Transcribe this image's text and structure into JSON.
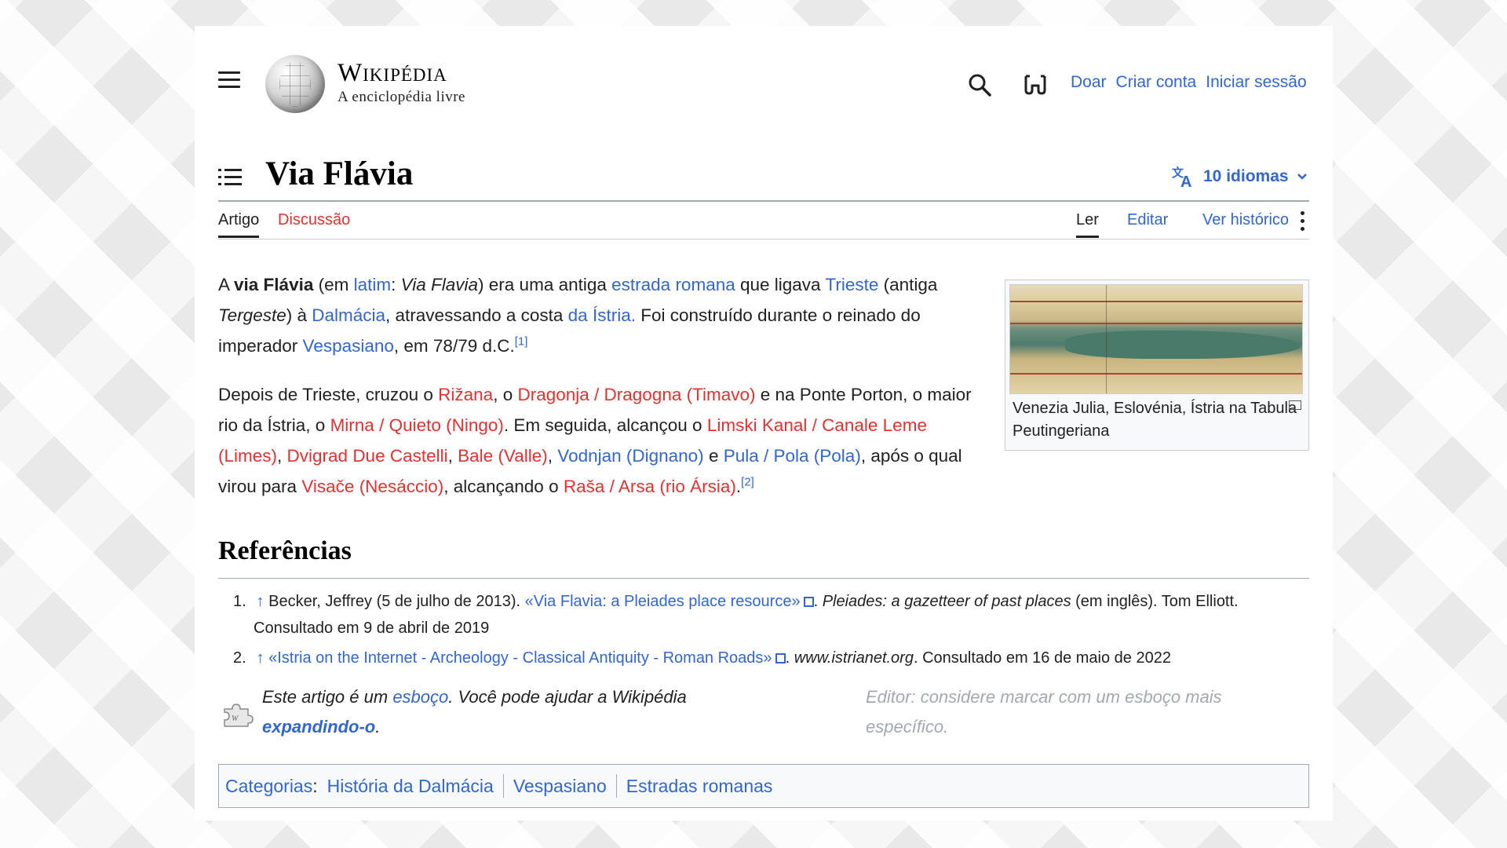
{
  "header": {
    "wordmark_title": "Wikipédia",
    "wordmark_tagline": "A enciclopédia livre",
    "links": [
      "Doar",
      "Criar conta",
      "Iniciar sessão"
    ]
  },
  "title_bar": {
    "title": "Via Flávia",
    "languages_label": "10 idiomas"
  },
  "tabs": {
    "left": [
      "Artigo",
      "Discussão"
    ],
    "right": [
      "Ler",
      "Editar",
      "Ver histórico"
    ]
  },
  "content": {
    "p1": {
      "t1": "A ",
      "bold": "via Flávia",
      "t2": " (em ",
      "l_latim": "latim",
      "t3": ": ",
      "i_latin": "Via Flavia",
      "t4": ") era uma antiga ",
      "l_estrada": "estrada romana",
      "t5": " que ligava ",
      "l_trieste": "Trieste",
      "t6": " (antiga ",
      "i_tergeste": "Tergeste",
      "t7": ") à ",
      "l_dalmacia": "Dalmácia",
      "t8": ", atravessando a costa ",
      "l_istria": "da Ístria.",
      "t9": " Foi construído durante o reinado do imperador ",
      "l_vespasiano": "Vespasiano",
      "t10": ", em 78/79 d.C.",
      "ref": "[1]"
    },
    "p2": {
      "t1": "Depois de Trieste, cruzou o ",
      "r_rizana": "Rižana",
      "t2": ", o ",
      "r_dragonja": "Dragonja / Dragogna (Timavo)",
      "t3": " e na Ponte Porton, o maior rio da Ístria, o ",
      "r_mirna": "Mirna / Quieto (Ningo)",
      "t4": ". Em seguida, alcançou o ",
      "r_limski": "Limski Kanal / Canale Leme (Limes)",
      "t5": ", ",
      "r_dvigrad": "Dvigrad Due Castelli",
      "t6": ", ",
      "r_bale": "Bale (Valle)",
      "t7": ", ",
      "l_vodnjan": "Vodnjan (Dignano)",
      "t8": " e ",
      "l_pula": "Pula / Pola (Pola)",
      "t9": ", após o qual virou para ",
      "r_visace": "Visače (Nesáccio)",
      "t10": ", alcançando o ",
      "r_rasa": "Raša / Arsa (rio Ársia)",
      "t11": ".",
      "ref": "[2]"
    }
  },
  "thumbnail": {
    "caption": "Venezia Julia, Eslovénia, Ístria na Tabula Peutingeriana"
  },
  "references": {
    "heading": "Referências",
    "items": [
      {
        "num": "1.",
        "arrow": "↑",
        "author": " Becker, Jeffrey (5 de julho de 2013). ",
        "link": "«Via Flavia: a Pleiades place resource»",
        "work": "Pleiades: a gazetteer of past places",
        "rest": " (em inglês). Tom Elliott. Consultado em 9 de abril de 2019"
      },
      {
        "num": "2.",
        "arrow": "↑",
        "link": "«Istria on the Internet - Archeology - Classical Antiquity - Roman Roads»",
        "work": "www.istrianet.org",
        "rest": ". Consultado em 16 de maio de 2022"
      }
    ]
  },
  "stub": {
    "t1": "Este artigo é um ",
    "l_esboco": "esboço",
    "t2": ". Você pode ajudar a Wikipédia ",
    "l_expand": "expandindo-o",
    "t3": ".",
    "r1": "Editor: considere marcar com um ",
    "r_link": "esboço",
    "r2": " mais específico."
  },
  "categories": {
    "label": "Categorias",
    "items": [
      "História da Dalmácia",
      "Vespasiano",
      "Estradas romanas"
    ]
  }
}
